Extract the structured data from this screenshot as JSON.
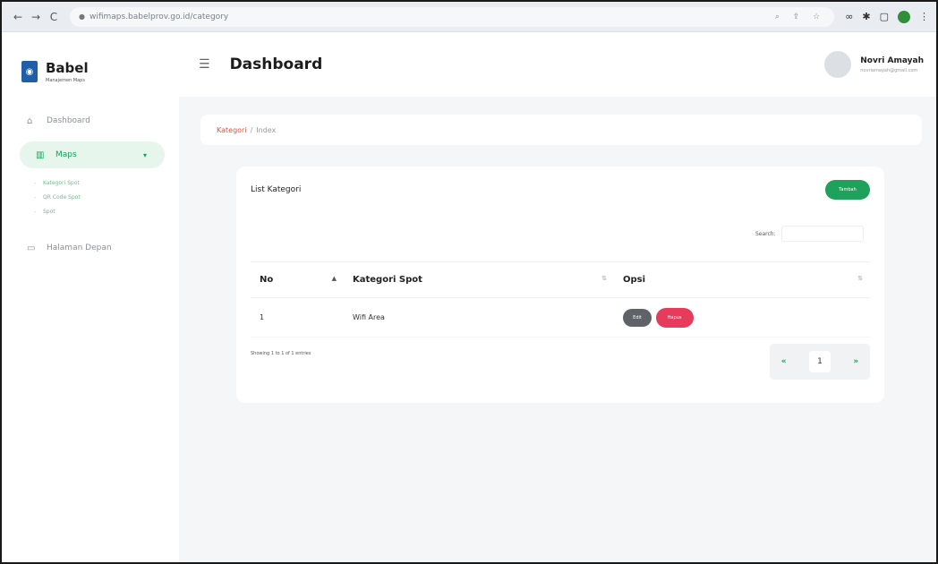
{
  "browser": {
    "url": "wifimaps.babelprov.go.id/category",
    "nav": {
      "back": "←",
      "forward": "→",
      "reload": "C"
    }
  },
  "sidebar": {
    "brand_title": "Babel",
    "brand_subtitle": "Manajemen Maps",
    "items": [
      {
        "label": "Dashboard"
      },
      {
        "label": "Maps"
      },
      {
        "label": "Halaman Depan"
      }
    ],
    "submenu": [
      {
        "label": "Kategori Spot"
      },
      {
        "label": "QR Code Spot"
      },
      {
        "label": "Spot"
      }
    ]
  },
  "header": {
    "title": "Dashboard",
    "user_name": "Novri Amayah",
    "user_email": "novriamayah@gmail.com"
  },
  "breadcrumb": {
    "active": "Kategori",
    "separator": "/",
    "current": "Index"
  },
  "card": {
    "title": "List Kategori",
    "add_button": "Tambah",
    "search_label": "Search:",
    "search_value": ""
  },
  "table": {
    "columns": [
      "No",
      "Kategori Spot",
      "Opsi"
    ],
    "rows": [
      {
        "no": "1",
        "kategori": "Wifi Area",
        "edit": "Edit",
        "delete": "Hapus"
      }
    ]
  },
  "footer": {
    "showing": "Showing 1 to 1 of 1 entries",
    "prev": "«",
    "page": "1",
    "next": "»"
  },
  "colors": {
    "accent": "#1ea25b",
    "danger": "#e63b5a",
    "breadcrumb_active": "#e0533e"
  }
}
